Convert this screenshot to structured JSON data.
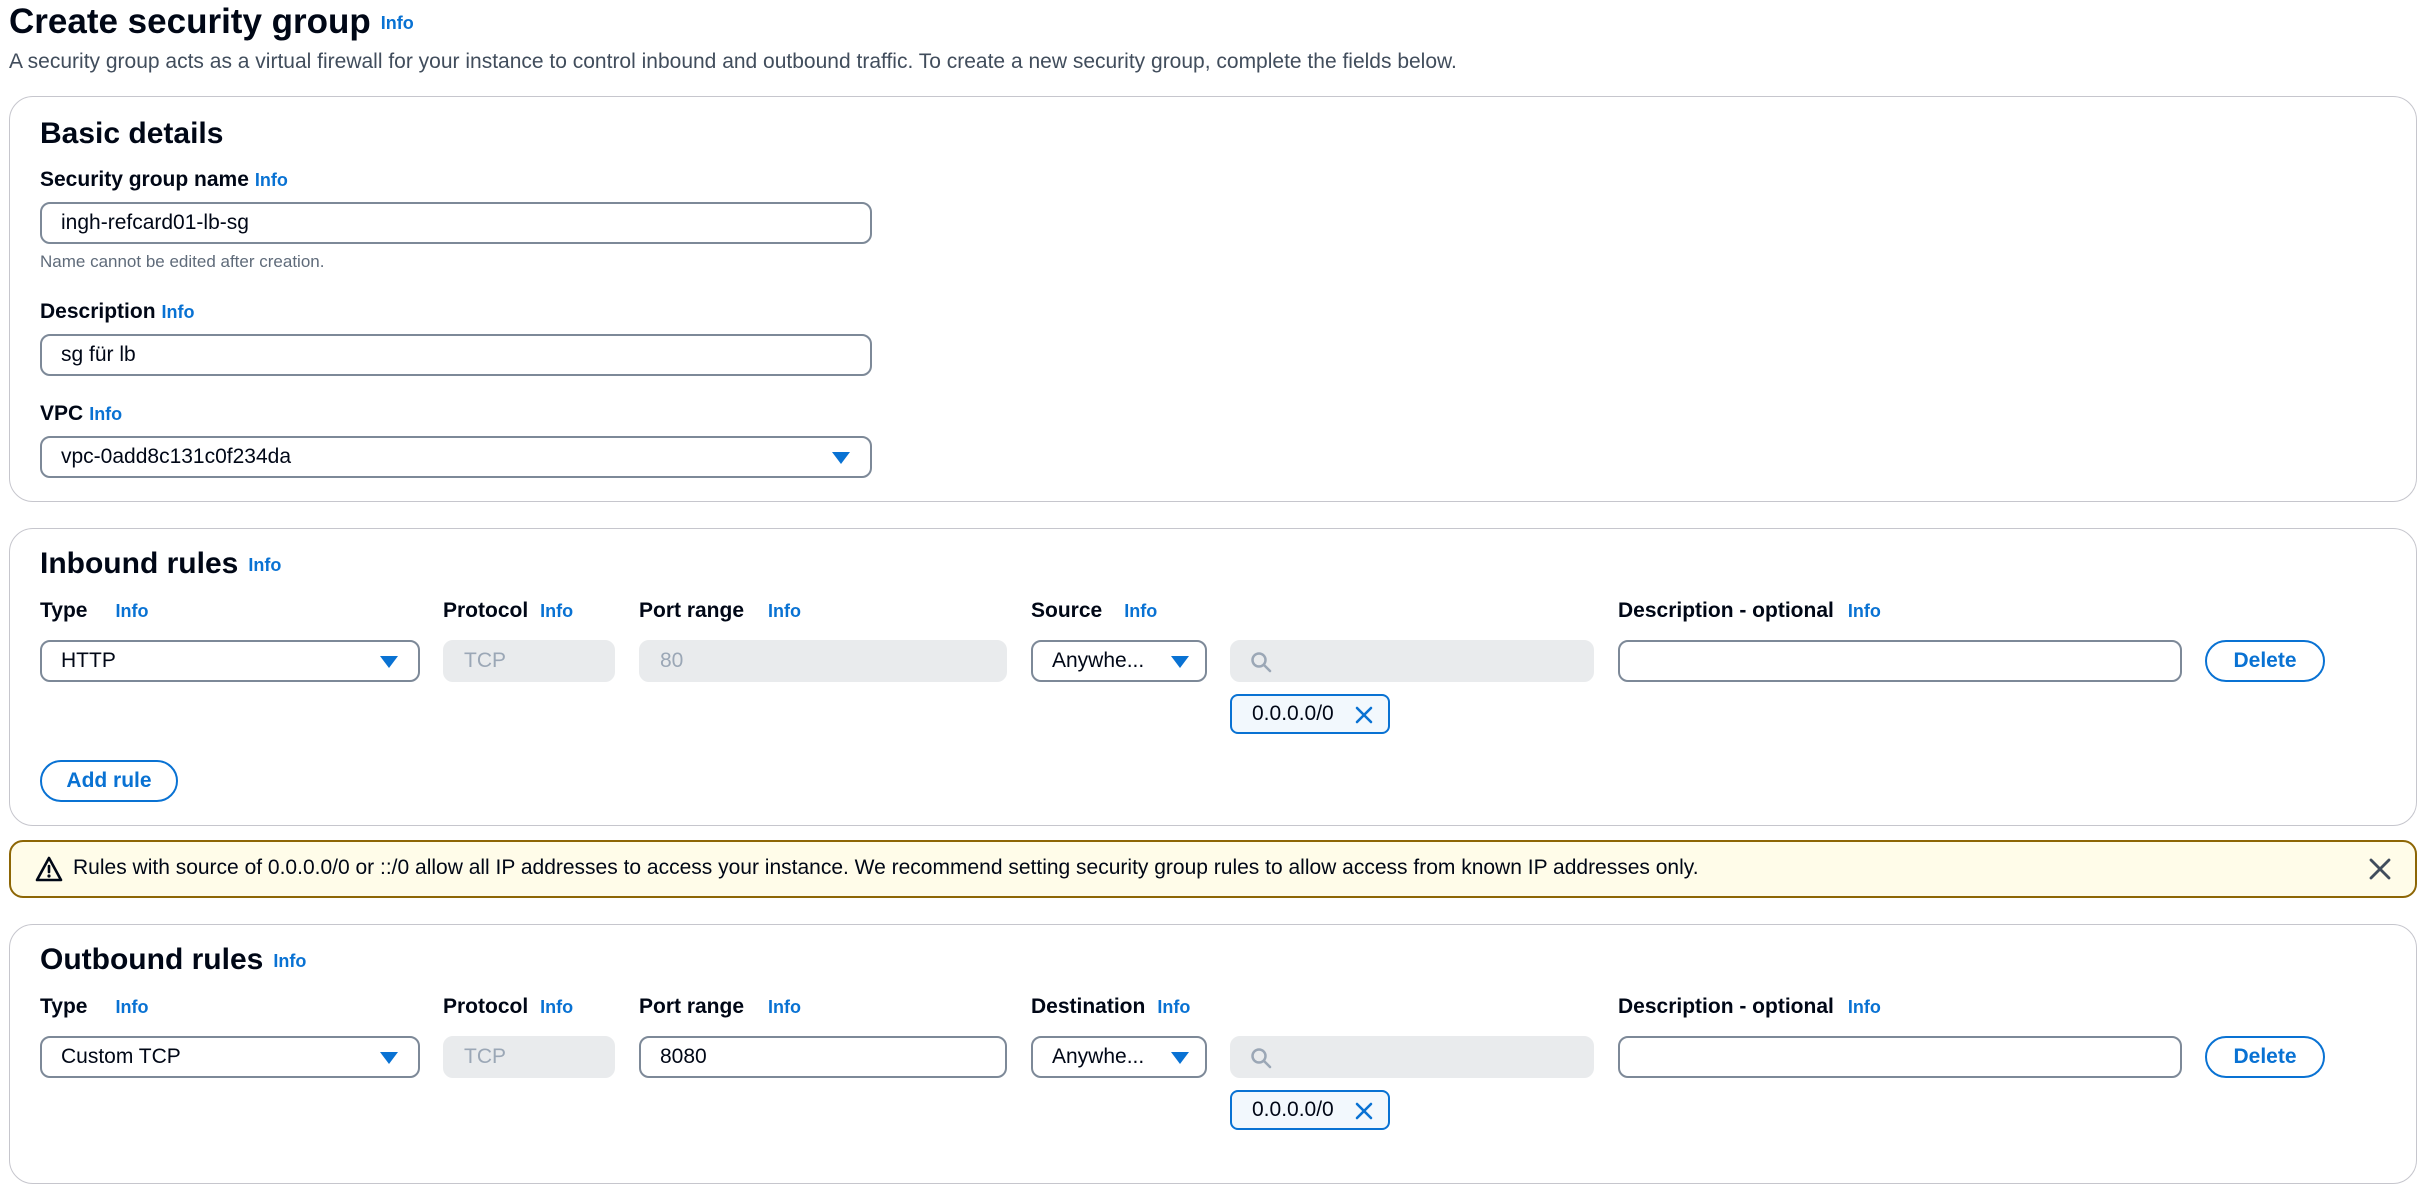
{
  "header": {
    "title": "Create security group",
    "info": "Info",
    "description": "A security group acts as a virtual firewall for your instance to control inbound and outbound traffic. To create a new security group, complete the fields below."
  },
  "basic_details": {
    "title": "Basic details",
    "name_label": "Security group name",
    "name_value": "ingh-refcard01-lb-sg",
    "name_hint": "Name cannot be edited after creation.",
    "description_label": "Description",
    "description_value": "sg für lb",
    "vpc_label": "VPC",
    "vpc_value": "vpc-0add8c131c0f234da",
    "info": "Info"
  },
  "inbound": {
    "title": "Inbound rules",
    "info": "Info",
    "columns": {
      "type": "Type",
      "protocol": "Protocol",
      "port_range": "Port range",
      "source": "Source",
      "description": "Description - optional"
    },
    "rule": {
      "type": "HTTP",
      "protocol": "TCP",
      "port_range": "80",
      "source": "Anywhe...",
      "search_value": "",
      "cidr_token": "0.0.0.0/0",
      "description_value": ""
    },
    "delete_label": "Delete",
    "add_rule_label": "Add rule"
  },
  "alert": {
    "text": "Rules with source of 0.0.0.0/0 or ::/0 allow all IP addresses to access your instance. We recommend setting security group rules to allow access from known IP addresses only."
  },
  "outbound": {
    "title": "Outbound rules",
    "info": "Info",
    "columns": {
      "type": "Type",
      "protocol": "Protocol",
      "port_range": "Port range",
      "destination": "Destination",
      "description": "Description - optional"
    },
    "rule": {
      "type": "Custom TCP",
      "protocol": "TCP",
      "port_range": "8080",
      "destination": "Anywhe...",
      "search_value": "",
      "cidr_token": "0.0.0.0/0",
      "description_value": ""
    },
    "delete_label": "Delete"
  },
  "colors": {
    "accent": "#0972d3",
    "warning_border": "#8d6605",
    "warning_bg": "#fffce9"
  }
}
